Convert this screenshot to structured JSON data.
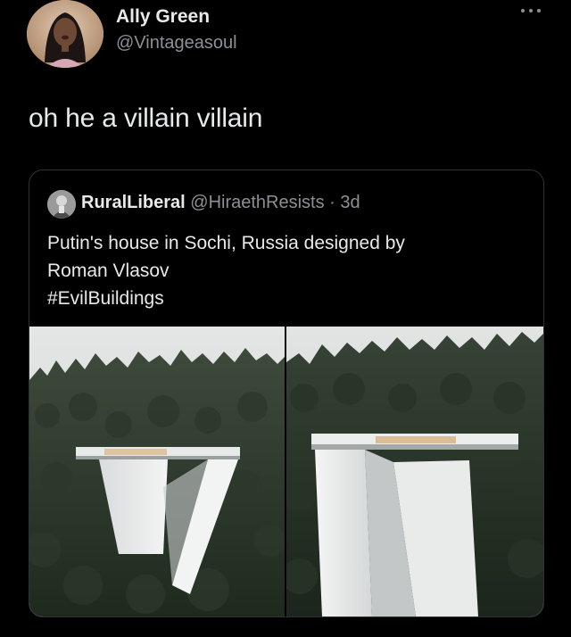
{
  "tweet": {
    "author_name": "Ally Green",
    "author_handle": "@Vintageasoul",
    "text": "oh he a villain villain",
    "more_icon": "ellipsis-icon"
  },
  "quoted_tweet": {
    "author_name": "RuralLiberal",
    "author_handle": "@HiraethResists",
    "separator": "·",
    "time": "3d",
    "text_lines": [
      "Putin's house in Sochi, Russia designed by",
      "Roman Vlasov",
      "#EvilBuildings"
    ],
    "media": [
      {
        "name": "house-photo-left"
      },
      {
        "name": "house-photo-right"
      }
    ]
  },
  "colors": {
    "background": "#000000",
    "text": "#e7e9ea",
    "secondary_text": "#8b9096",
    "border": "#2f3336"
  }
}
